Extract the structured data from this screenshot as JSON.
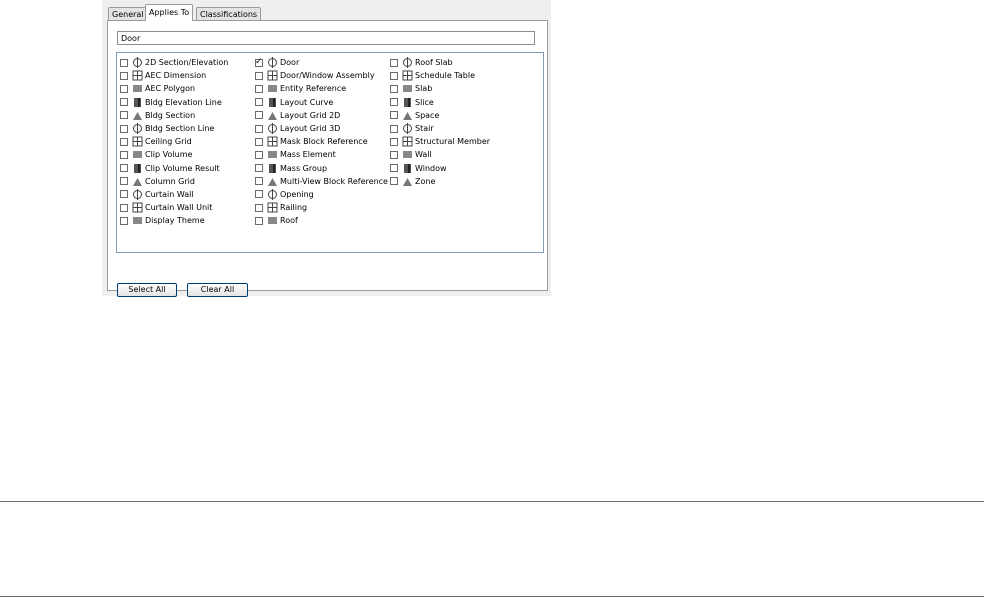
{
  "tabs": [
    {
      "label": "General",
      "active": false
    },
    {
      "label": "Applies To",
      "active": true
    },
    {
      "label": "Classifications",
      "active": false
    }
  ],
  "name_field": {
    "value": "Door"
  },
  "object_types": {
    "col1": [
      {
        "label": "2D Section/Elevation",
        "checked": false,
        "icon": "section-elevation-icon"
      },
      {
        "label": "AEC Dimension",
        "checked": false,
        "icon": "dimension-icon"
      },
      {
        "label": "AEC Polygon",
        "checked": false,
        "icon": "polygon-icon"
      },
      {
        "label": "Bldg Elevation Line",
        "checked": false,
        "icon": "elevation-line-icon"
      },
      {
        "label": "Bldg Section",
        "checked": false,
        "icon": "bldg-section-icon"
      },
      {
        "label": "Bldg Section Line",
        "checked": false,
        "icon": "section-line-icon"
      },
      {
        "label": "Ceiling Grid",
        "checked": false,
        "icon": "ceiling-grid-icon"
      },
      {
        "label": "Clip Volume",
        "checked": false,
        "icon": "clip-volume-icon"
      },
      {
        "label": "Clip Volume Result",
        "checked": false,
        "icon": "clip-volume-result-icon"
      },
      {
        "label": "Column Grid",
        "checked": false,
        "icon": "column-grid-icon"
      },
      {
        "label": "Curtain Wall",
        "checked": false,
        "icon": "curtain-wall-icon"
      },
      {
        "label": "Curtain Wall Unit",
        "checked": false,
        "icon": "curtain-wall-unit-icon"
      },
      {
        "label": "Display Theme",
        "checked": false,
        "icon": "display-theme-icon"
      }
    ],
    "col2": [
      {
        "label": "Door",
        "checked": true,
        "icon": "door-icon"
      },
      {
        "label": "Door/Window Assembly",
        "checked": false,
        "icon": "door-window-assembly-icon"
      },
      {
        "label": "Entity Reference",
        "checked": false,
        "icon": "entity-reference-icon"
      },
      {
        "label": "Layout Curve",
        "checked": false,
        "icon": "layout-curve-icon"
      },
      {
        "label": "Layout Grid 2D",
        "checked": false,
        "icon": "layout-grid-2d-icon"
      },
      {
        "label": "Layout Grid 3D",
        "checked": false,
        "icon": "layout-grid-3d-icon"
      },
      {
        "label": "Mask Block Reference",
        "checked": false,
        "icon": "mask-block-icon"
      },
      {
        "label": "Mass Element",
        "checked": false,
        "icon": "mass-element-icon"
      },
      {
        "label": "Mass Group",
        "checked": false,
        "icon": "mass-group-icon"
      },
      {
        "label": "Multi-View Block Reference",
        "checked": false,
        "icon": "multi-view-block-icon"
      },
      {
        "label": "Opening",
        "checked": false,
        "icon": "opening-icon"
      },
      {
        "label": "Railing",
        "checked": false,
        "icon": "railing-icon"
      },
      {
        "label": "Roof",
        "checked": false,
        "icon": "roof-icon"
      }
    ],
    "col3": [
      {
        "label": "Roof Slab",
        "checked": false,
        "icon": "roof-slab-icon"
      },
      {
        "label": "Schedule Table",
        "checked": false,
        "icon": "schedule-table-icon"
      },
      {
        "label": "Slab",
        "checked": false,
        "icon": "slab-icon"
      },
      {
        "label": "Slice",
        "checked": false,
        "icon": "slice-icon"
      },
      {
        "label": "Space",
        "checked": false,
        "icon": "space-icon"
      },
      {
        "label": "Stair",
        "checked": false,
        "icon": "stair-icon"
      },
      {
        "label": "Structural Member",
        "checked": false,
        "icon": "structural-member-icon"
      },
      {
        "label": "Wall",
        "checked": false,
        "icon": "wall-icon"
      },
      {
        "label": "Window",
        "checked": false,
        "icon": "window-icon"
      },
      {
        "label": "Zone",
        "checked": false,
        "icon": "zone-icon"
      }
    ]
  },
  "buttons": {
    "select_all": "Select All",
    "clear_all": "Clear All"
  },
  "colors": {
    "list_border": "#7f9db9",
    "button_border": "#003c74",
    "panel_bg": "#efefef"
  }
}
